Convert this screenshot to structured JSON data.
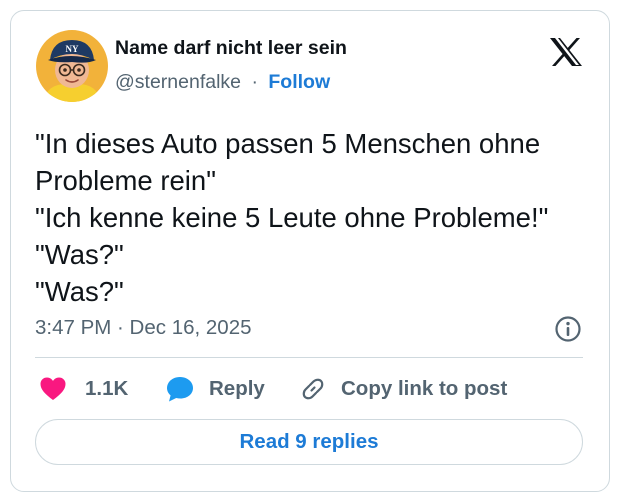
{
  "author": {
    "display_name": "Name darf nicht leer sein",
    "handle": "@sternenfalke",
    "separator": "·",
    "follow_label": "Follow",
    "avatar_icon": "cartoon-avatar-icon"
  },
  "platform": {
    "logo_icon": "x-logo-icon"
  },
  "tweet": {
    "lines": [
      "\"In dieses Auto passen 5 Menschen ohne",
      "Probleme rein\"",
      "\"Ich kenne keine 5 Leute ohne Probleme!\"",
      "\"Was?\"",
      "\"Was?\""
    ],
    "timestamp": "3:47 PM · Dec 16, 2025",
    "info_icon": "info-icon"
  },
  "actions": {
    "like_count": "1.1K",
    "reply_label": "Reply",
    "copy_label": "Copy link to post",
    "read_replies_label": "Read 9 replies"
  },
  "colors": {
    "accent_blue": "#1d7bd6",
    "like_pink": "#f91880",
    "reply_blue": "#1d9bf0",
    "secondary_text": "#536471",
    "border": "#cfd9de"
  }
}
